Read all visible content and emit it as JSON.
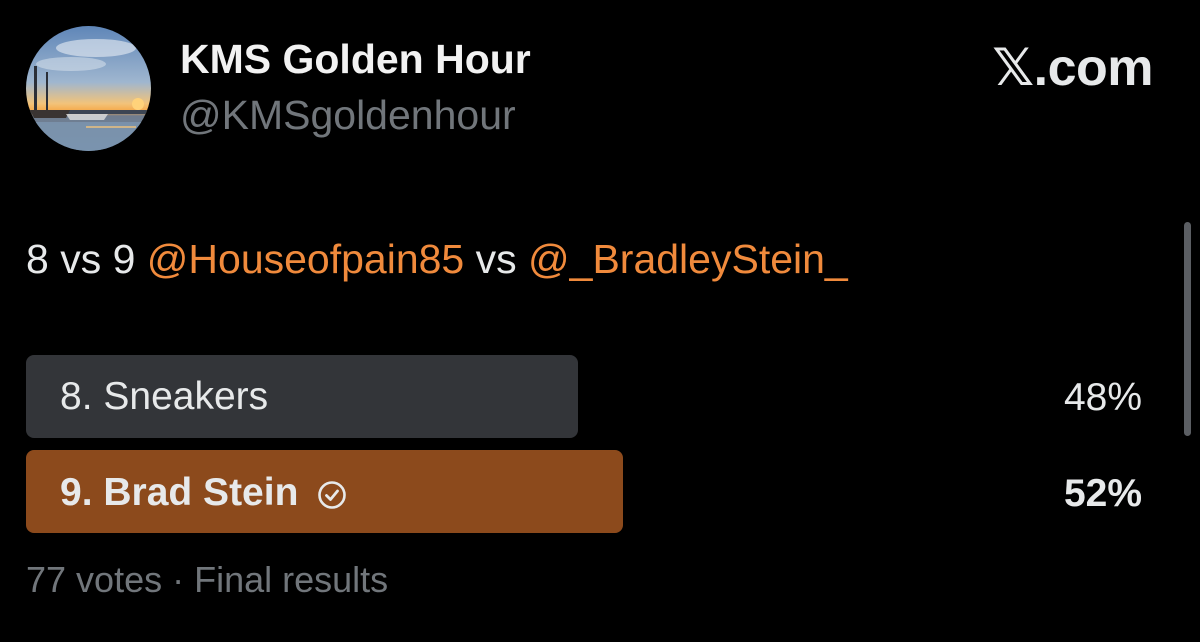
{
  "header": {
    "display_name": "KMS Golden Hour",
    "handle": "@KMSgoldenhour",
    "brand_x": "𝕏",
    "brand_suffix": ".com"
  },
  "tweet": {
    "prefix": "8 vs 9 ",
    "mention_1": "@Houseofpain85",
    "joiner": " vs ",
    "mention_2": "@_BradleyStein_"
  },
  "poll": {
    "options": [
      {
        "label": "8. Sneakers",
        "percent": "48%",
        "winner": false
      },
      {
        "label": "9. Brad Stein",
        "percent": "52%",
        "winner": true
      }
    ],
    "meta": "77 votes · Final results"
  },
  "colors": {
    "background": "#000000",
    "text": "#e7e9ea",
    "muted": "#71767b",
    "mention": "#f08a3c",
    "loser_bar": "#333539",
    "winner_bar": "#8c4a1c"
  },
  "icons": {
    "avatar": "sunset-harbor-avatar",
    "winner": "check-circle-icon",
    "brand": "x-logo-icon"
  }
}
